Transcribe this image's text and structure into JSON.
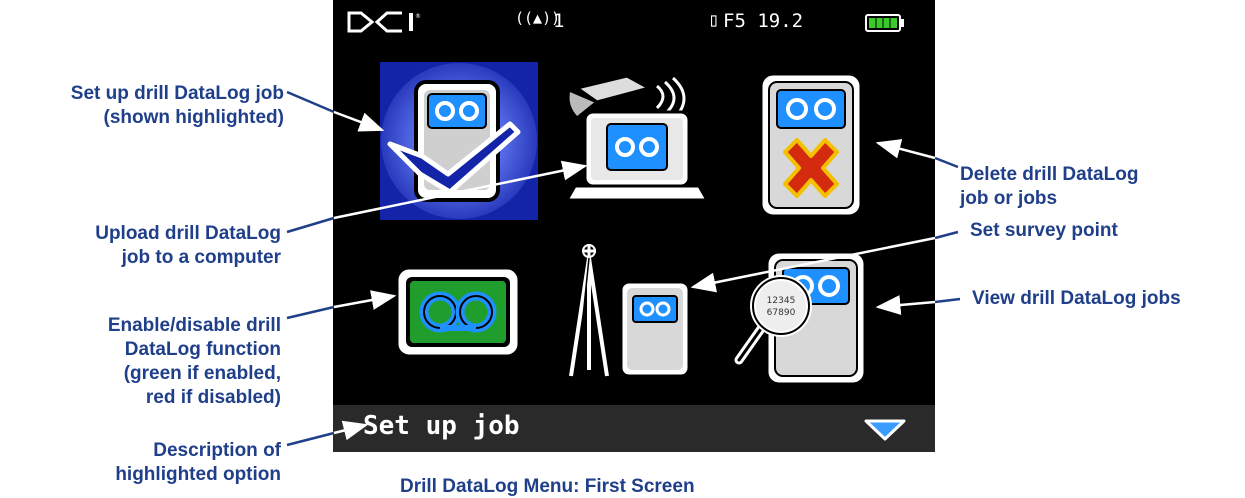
{
  "status_bar": {
    "brand": "DCI",
    "signal_text": "1",
    "frequency_text": "F5 19.2"
  },
  "description_bar": {
    "text": "Set up job"
  },
  "callouts": {
    "set_up_line1": "Set up drill DataLog job",
    "set_up_line2": "(shown highlighted)",
    "upload_line1": "Upload drill DataLog",
    "upload_line2": "job to a computer",
    "enable_line1": "Enable/disable drill",
    "enable_line2": "DataLog function",
    "enable_line3": "(green if enabled,",
    "enable_line4": "red if disabled)",
    "description_line1": "Description of",
    "description_line2": "highlighted option",
    "delete_line1": "Delete drill DataLog",
    "delete_line2": "job or jobs",
    "survey": "Set survey point",
    "view": "View drill DataLog jobs"
  },
  "caption": "Drill DataLog Menu: First Screen",
  "icons": [
    {
      "name": "set-up-job-icon",
      "highlighted": true
    },
    {
      "name": "upload-job-icon",
      "highlighted": false
    },
    {
      "name": "delete-job-icon",
      "highlighted": false
    },
    {
      "name": "enable-datalog-icon",
      "highlighted": false,
      "state_color": "#1f9e2e"
    },
    {
      "name": "survey-point-icon",
      "highlighted": false
    },
    {
      "name": "view-jobs-icon",
      "highlighted": false,
      "magnifier_text": "12345 67890"
    }
  ],
  "colors": {
    "callout_text": "#1f3f8a",
    "highlight_bg": "#1424a8",
    "tape_blue": "#1e90ff",
    "enabled_green": "#1f9e2e",
    "delete_red": "#d42a10",
    "battery_green": "#3acb2a"
  }
}
